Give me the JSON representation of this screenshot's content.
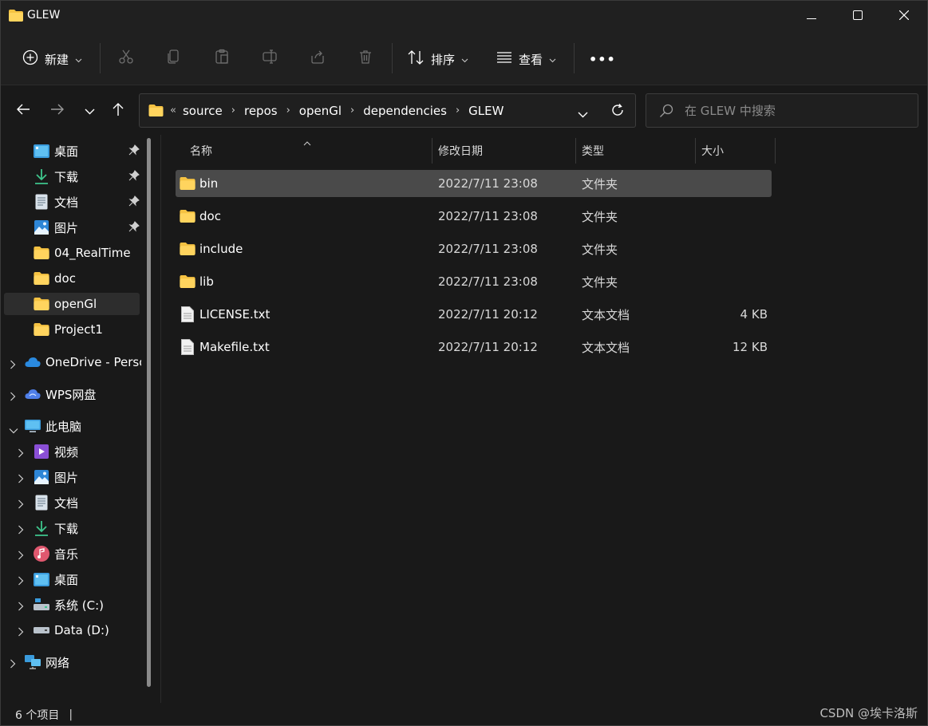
{
  "window": {
    "title": "GLEW",
    "minimize_icon": "minimize-icon",
    "maximize_icon": "maximize-icon",
    "close_icon": "close-icon"
  },
  "commandbar": {
    "new_label": "新建",
    "sort_label": "排序",
    "view_label": "查看",
    "more_label": "•••"
  },
  "navigation": {
    "breadcrumb": [
      "source",
      "repos",
      "openGl",
      "dependencies",
      "GLEW"
    ],
    "overflow": "«",
    "search_placeholder": "在 GLEW 中搜索"
  },
  "sidebar": {
    "quick_access": [
      {
        "label": "桌面",
        "icon": "desktop-icon",
        "pinned": true
      },
      {
        "label": "下载",
        "icon": "download-icon",
        "pinned": true
      },
      {
        "label": "文档",
        "icon": "document-icon",
        "pinned": true
      },
      {
        "label": "图片",
        "icon": "pictures-icon",
        "pinned": true
      },
      {
        "label": "04_RealTime",
        "icon": "folder-icon",
        "pinned": false
      },
      {
        "label": "doc",
        "icon": "folder-icon",
        "pinned": false
      },
      {
        "label": "openGl",
        "icon": "folder-icon",
        "pinned": false,
        "selected": true
      },
      {
        "label": "Project1",
        "icon": "folder-icon",
        "pinned": false
      }
    ],
    "onedrive": "OneDrive - Perso",
    "wps": "WPS网盘",
    "this_pc": "此电脑",
    "pc_items": [
      {
        "label": "视频",
        "icon": "videos-icon"
      },
      {
        "label": "图片",
        "icon": "pictures-icon"
      },
      {
        "label": "文档",
        "icon": "document-icon"
      },
      {
        "label": "下载",
        "icon": "download-icon"
      },
      {
        "label": "音乐",
        "icon": "music-icon"
      },
      {
        "label": "桌面",
        "icon": "desktop-icon"
      },
      {
        "label": "系统 (C:)",
        "icon": "drive-c-icon"
      },
      {
        "label": "Data (D:)",
        "icon": "drive-d-icon"
      }
    ],
    "network": "网络"
  },
  "file_list": {
    "columns": {
      "name": "名称",
      "date": "修改日期",
      "type": "类型",
      "size": "大小"
    },
    "rows": [
      {
        "name": "bin",
        "date": "2022/7/11 23:08",
        "type": "文件夹",
        "size": "",
        "kind": "folder",
        "selected": true
      },
      {
        "name": "doc",
        "date": "2022/7/11 23:08",
        "type": "文件夹",
        "size": "",
        "kind": "folder"
      },
      {
        "name": "include",
        "date": "2022/7/11 23:08",
        "type": "文件夹",
        "size": "",
        "kind": "folder"
      },
      {
        "name": "lib",
        "date": "2022/7/11 23:08",
        "type": "文件夹",
        "size": "",
        "kind": "folder"
      },
      {
        "name": "LICENSE.txt",
        "date": "2022/7/11 20:12",
        "type": "文本文档",
        "size": "4 KB",
        "kind": "file"
      },
      {
        "name": "Makefile.txt",
        "date": "2022/7/11 20:12",
        "type": "文本文档",
        "size": "12 KB",
        "kind": "file"
      }
    ]
  },
  "status": {
    "item_count": "6 个项目",
    "separator": "|"
  },
  "watermark": "CSDN @埃卡洛斯",
  "colors": {
    "folder": "#f5c242",
    "accent": "#4cc2ff"
  }
}
